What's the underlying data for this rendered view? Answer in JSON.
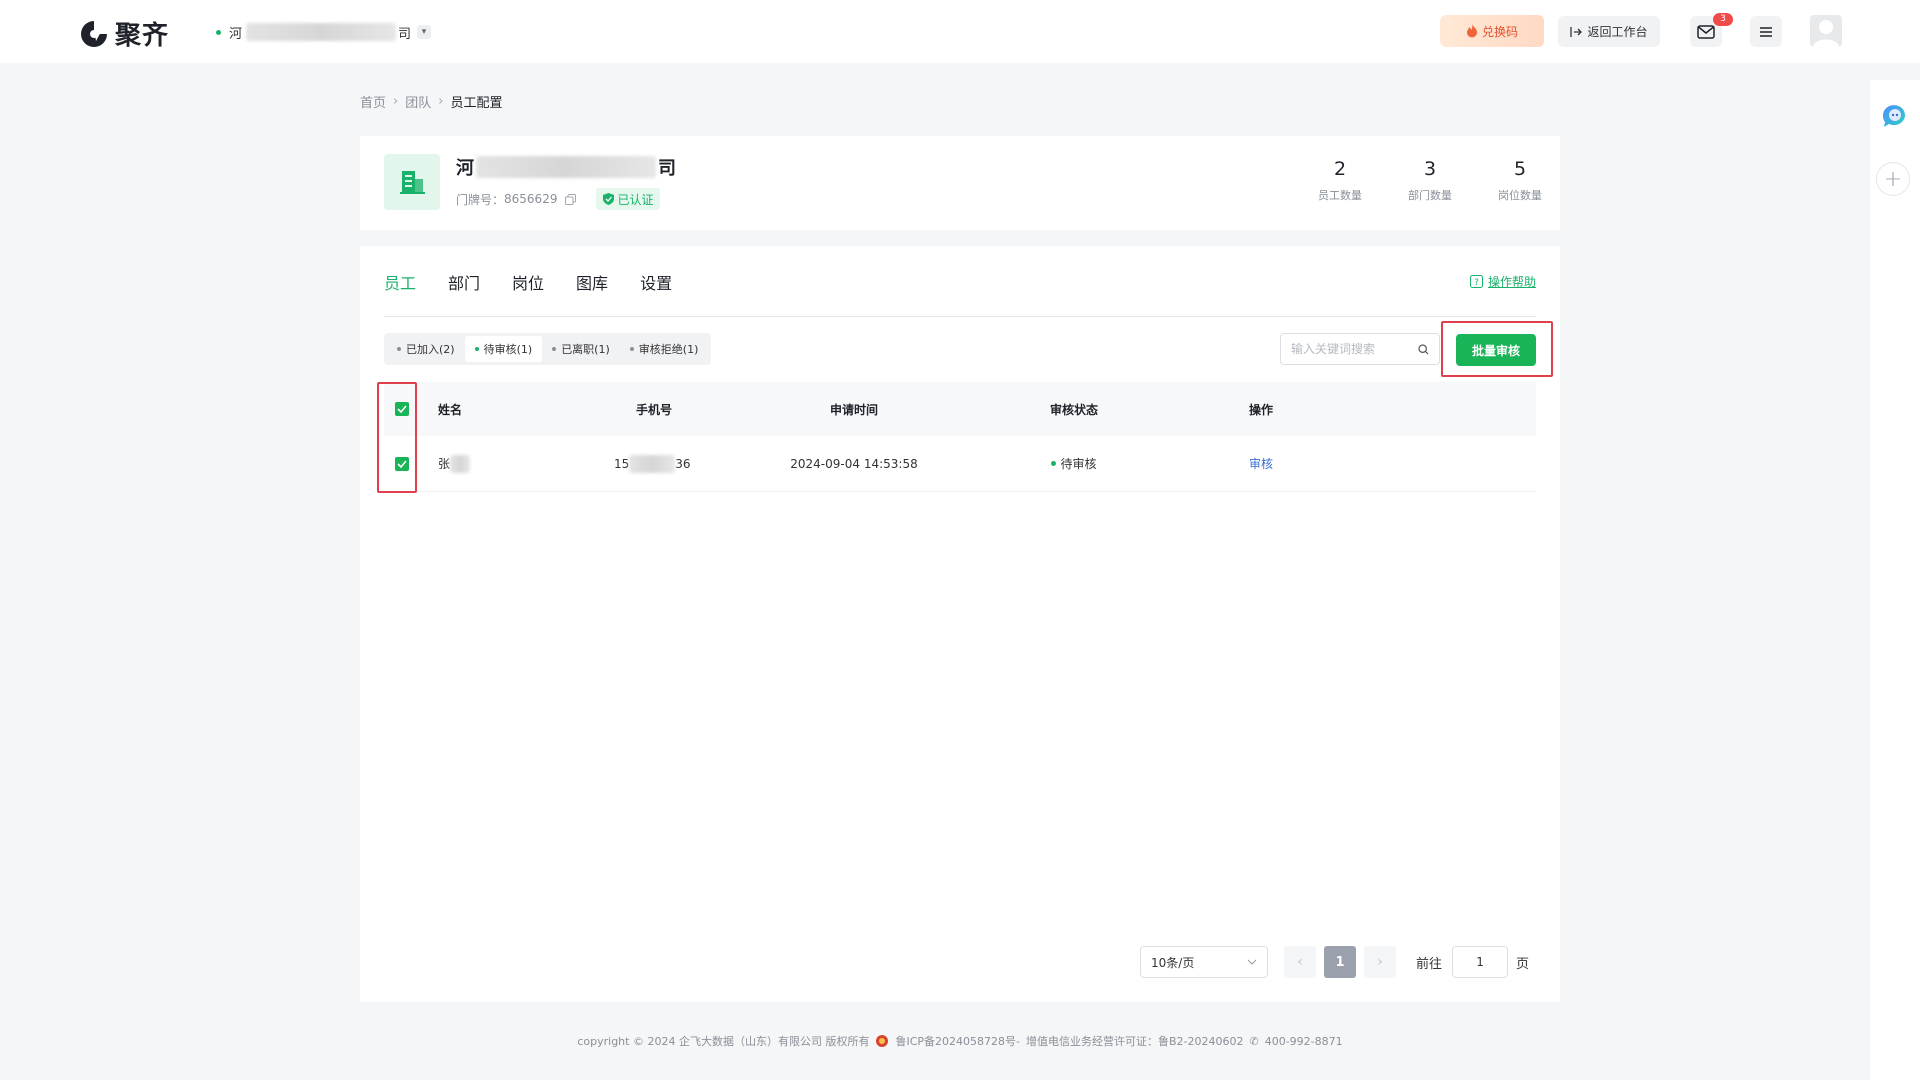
{
  "app": {
    "logo_text": "聚齐",
    "company_selector": {
      "prefix": "河",
      "suffix": "司"
    }
  },
  "topbar": {
    "redeem_label": "兑换码",
    "back_label": "返回工作台",
    "mail_badge": "3"
  },
  "breadcrumb": [
    "首页",
    "团队",
    "员工配置"
  ],
  "company": {
    "name_prefix": "河",
    "name_suffix": "司",
    "door_label": "门牌号：",
    "door_number": "8656629",
    "verified_label": "已认证",
    "stats": [
      {
        "value": "2",
        "label": "员工数量"
      },
      {
        "value": "3",
        "label": "部门数量"
      },
      {
        "value": "5",
        "label": "岗位数量"
      }
    ]
  },
  "tabs": [
    "员工",
    "部门",
    "岗位",
    "图库",
    "设置"
  ],
  "active_tab": "员工",
  "help_label": "操作帮助",
  "filters": [
    "已加入(2)",
    "待审核(1)",
    "已离职(1)",
    "审核拒绝(1)"
  ],
  "active_filter": "待审核(1)",
  "search": {
    "placeholder": "输入关键词搜索",
    "value": ""
  },
  "batch_button": "批量审核",
  "table": {
    "columns": [
      "姓名",
      "手机号",
      "申请时间",
      "审核状态",
      "操作"
    ],
    "header_checked": true,
    "rows": [
      {
        "checked": true,
        "name": "张",
        "phone_prefix": "15",
        "phone_suffix": "36",
        "time": "2024-09-04 14:53:58",
        "status": "待审核",
        "action": "审核"
      }
    ]
  },
  "pagination": {
    "page_size": "10条/页",
    "current_page": "1",
    "goto_label": "前往",
    "goto_value": "1",
    "page_unit": "页"
  },
  "footer": {
    "copyright": "copyright © 2024 企飞大数据（山东）有限公司 版权所有",
    "icp": "鲁ICP备2024058728号-",
    "license": "增值电信业务经营许可证：鲁B2-20240602",
    "phone": "400-992-8871"
  },
  "colors": {
    "accent": "#1ab26b",
    "button": "#19b358",
    "highlight": "#e0404d",
    "link": "#3b6fd6"
  }
}
